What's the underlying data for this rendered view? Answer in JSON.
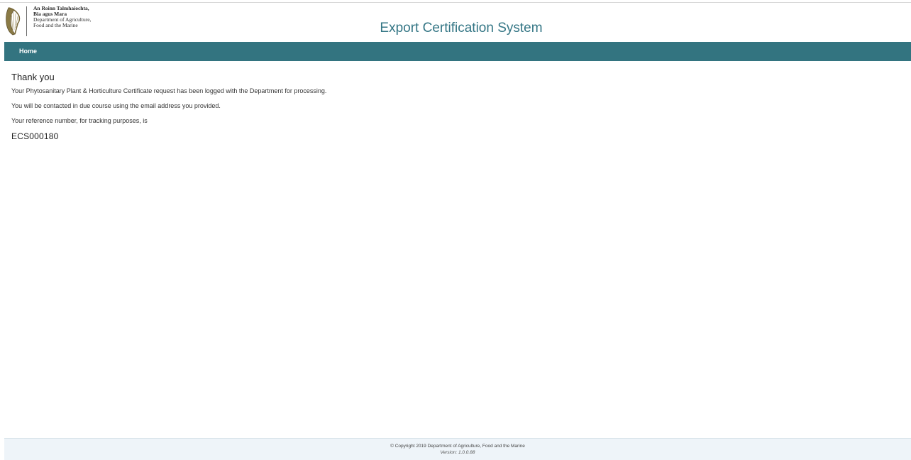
{
  "header": {
    "logo_lines_ga": [
      "An Roinn Talmhaíochta,",
      "Bia agus Mara"
    ],
    "logo_lines_en": [
      "Department of Agriculture,",
      "Food and the Marine"
    ],
    "app_title": "Export Certification System"
  },
  "nav": {
    "home_label": "Home"
  },
  "main": {
    "heading": "Thank you",
    "message_logged": "Your Phytosanitary Plant & Horticulture Certificate request has been logged with the Department for processing.",
    "message_contact": "You will be contacted in due course using the email address you provided.",
    "message_reference": "Your reference number, for tracking purposes, is",
    "reference_number": "ECS000180"
  },
  "footer": {
    "copyright": "© Copyright 2019 Department of Agriculture, Food and the Marine",
    "version": "Version: 1.0.0.88"
  },
  "colors": {
    "accent": "#337480",
    "title": "#347685",
    "footer_bg": "#eef4f9"
  },
  "icons": {
    "logo": "harp-icon"
  }
}
